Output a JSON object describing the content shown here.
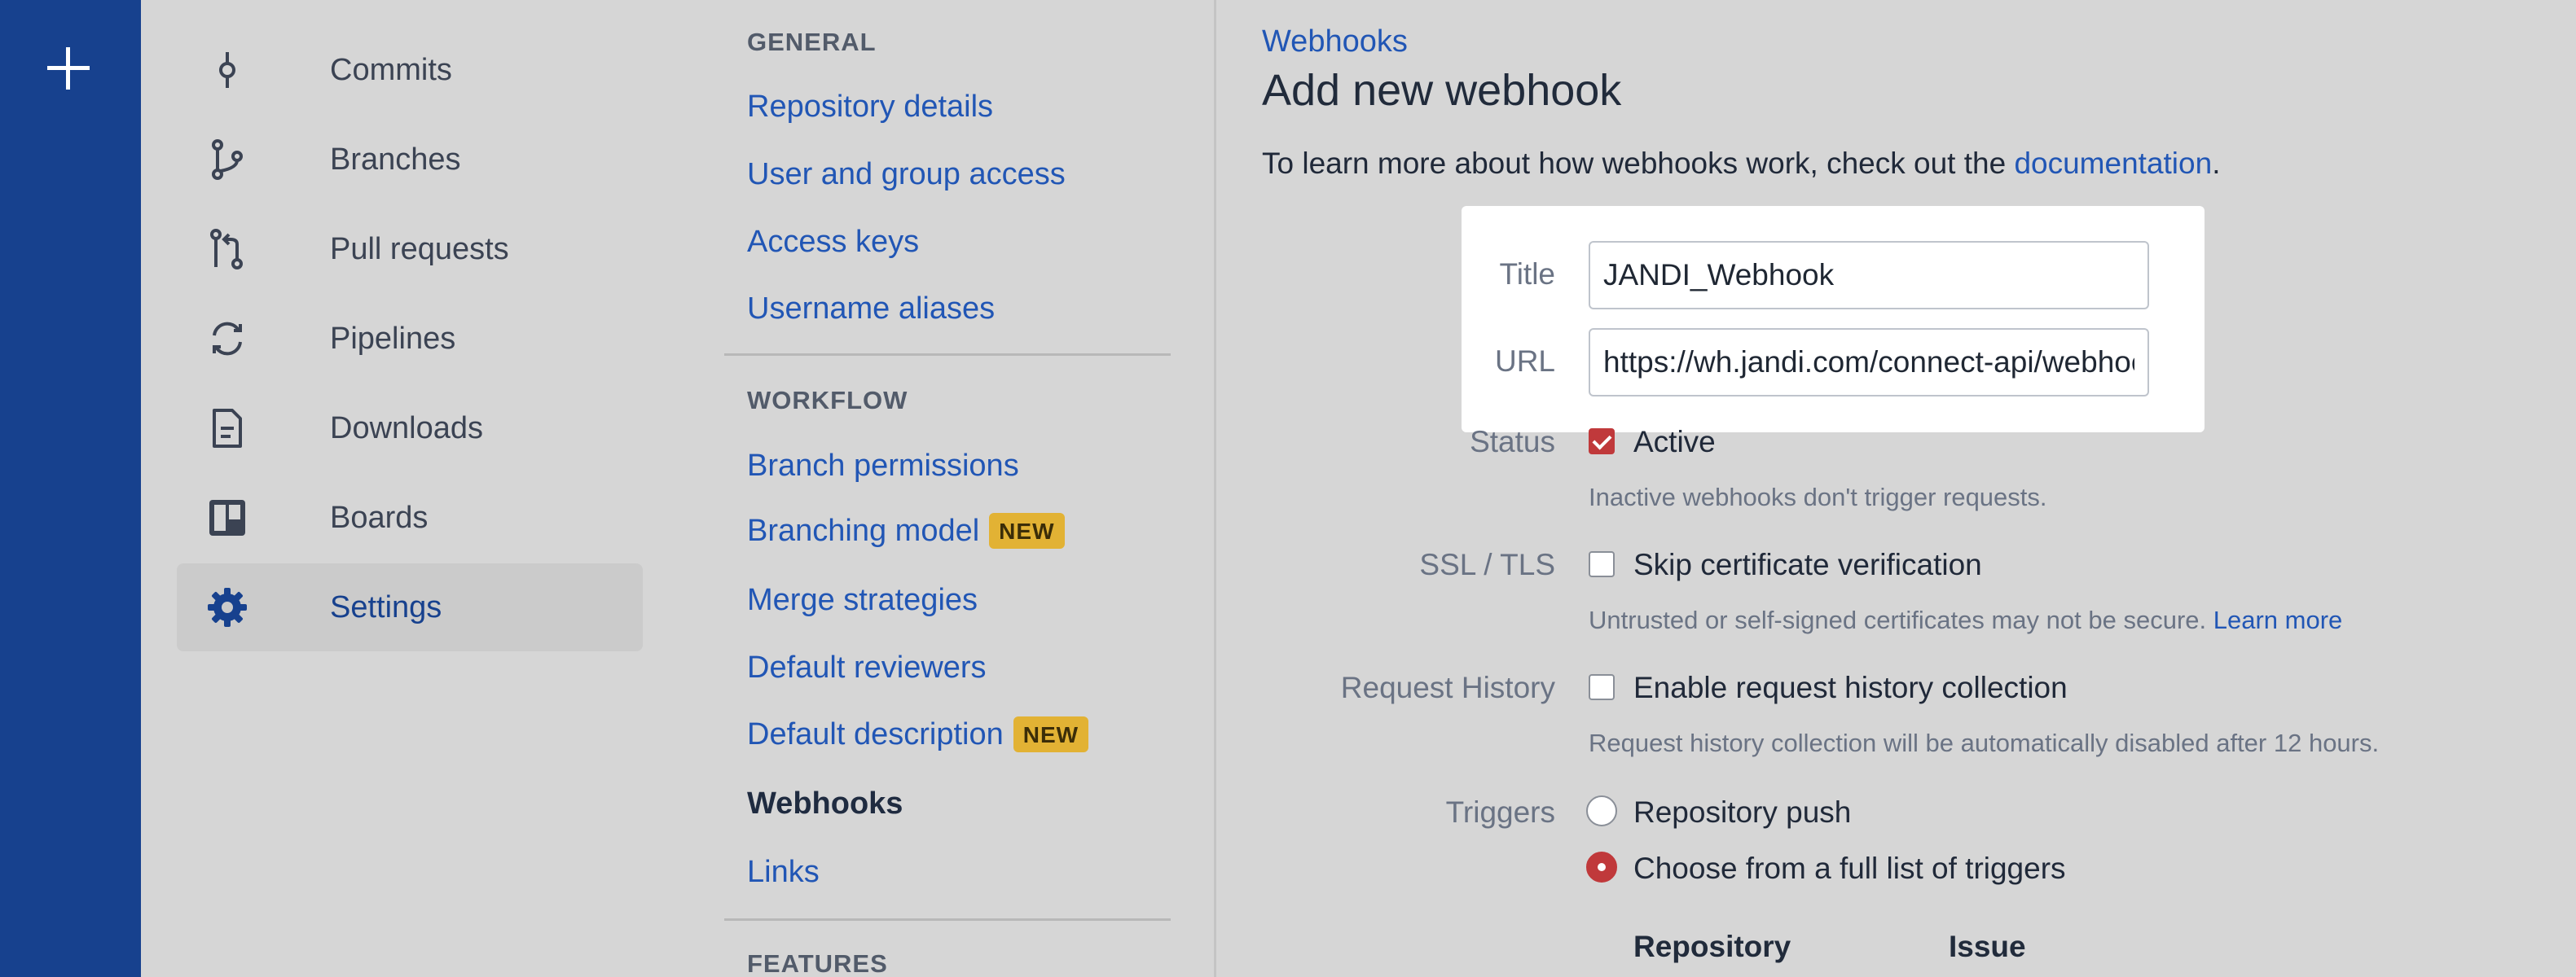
{
  "global_nav": {
    "create_icon": "plus-icon"
  },
  "repo_nav": {
    "items": [
      {
        "label": "Commits",
        "icon": "commit-icon"
      },
      {
        "label": "Branches",
        "icon": "branch-icon"
      },
      {
        "label": "Pull requests",
        "icon": "pull-request-icon"
      },
      {
        "label": "Pipelines",
        "icon": "pipelines-icon"
      },
      {
        "label": "Downloads",
        "icon": "document-icon"
      },
      {
        "label": "Boards",
        "icon": "board-icon"
      },
      {
        "label": "Settings",
        "icon": "gear-icon",
        "active": true
      }
    ]
  },
  "settings_nav": {
    "general_heading": "GENERAL",
    "general_links": [
      "Repository details",
      "User and group access",
      "Access keys",
      "Username aliases"
    ],
    "workflow_heading": "WORKFLOW",
    "workflow_links": [
      {
        "label": "Branch permissions"
      },
      {
        "label": "Branching model",
        "badge": "NEW"
      },
      {
        "label": "Merge strategies"
      },
      {
        "label": "Default reviewers"
      },
      {
        "label": "Default description",
        "badge": "NEW"
      },
      {
        "label": "Webhooks",
        "current": true
      },
      {
        "label": "Links"
      }
    ],
    "features_heading": "FEATURES"
  },
  "main": {
    "breadcrumb": "Webhooks",
    "title": "Add new webhook",
    "intro_text": "To learn more about how webhooks work, check out the",
    "intro_link": "documentation",
    "intro_end": ".",
    "form": {
      "title_label": "Title",
      "title_value": "JANDI_Webhook",
      "url_label": "URL",
      "url_value": "https://wh.jandi.com/connect-api/webhook",
      "status_label": "Status",
      "status_option": "Active",
      "status_checked": true,
      "status_help": "Inactive webhooks don't trigger requests.",
      "ssl_label": "SSL / TLS",
      "ssl_option": "Skip certificate verification",
      "ssl_checked": false,
      "ssl_help": "Untrusted or self-signed certificates may not be secure.",
      "ssl_help_link": "Learn more",
      "history_label": "Request History",
      "history_option": "Enable request history collection",
      "history_checked": false,
      "history_help": "Request history collection will be automatically disabled after 12 hours.",
      "triggers_label": "Triggers",
      "trigger_push": "Repository push",
      "trigger_full": "Choose from a full list of triggers",
      "selected_trigger": "Choose from a full list of triggers",
      "trigger_columns": [
        "Repository",
        "Issue"
      ]
    }
  },
  "colors": {
    "global_nav": "#17418e",
    "link": "#2156b5",
    "checked": "#c0393b",
    "badge": "#e2b234"
  }
}
